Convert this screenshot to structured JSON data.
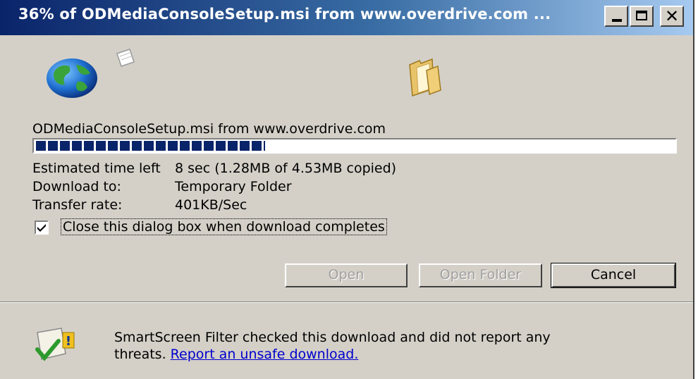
{
  "window": {
    "title": "36% of ODMediaConsoleSetup.msi from www.overdrive.com ...",
    "controls": {
      "minimize": "_",
      "maximize": "□",
      "close": "✕"
    }
  },
  "icons": {
    "source": "globe-icon",
    "transfer": "flying-paper-icon",
    "destination": "folder-icon",
    "smartscreen": "shield-check-icon"
  },
  "download": {
    "file_from": "ODMediaConsoleSetup.msi from www.overdrive.com",
    "progress_fraction": 0.36,
    "estimated_label": "Estimated time left",
    "estimated_value": "8 sec (1.28MB of 4.53MB copied)",
    "download_to_label": "Download to:",
    "download_to_value": "Temporary Folder",
    "transfer_rate_label": "Transfer rate:",
    "transfer_rate_value": "401KB/Sec"
  },
  "options": {
    "close_when_done_label": "Close this dialog box when download completes",
    "close_when_done_checked": true
  },
  "buttons": {
    "open": "Open",
    "open_folder": "Open Folder",
    "cancel": "Cancel"
  },
  "smartscreen": {
    "line1": "SmartScreen Filter checked this download and did not report any",
    "line2_prefix": "threats.",
    "report_link": "Report an unsafe download."
  },
  "colors": {
    "title_bar": "#0a246a",
    "progress": "#0a246a",
    "link": "#0000cc",
    "face": "#d4d0c8"
  }
}
